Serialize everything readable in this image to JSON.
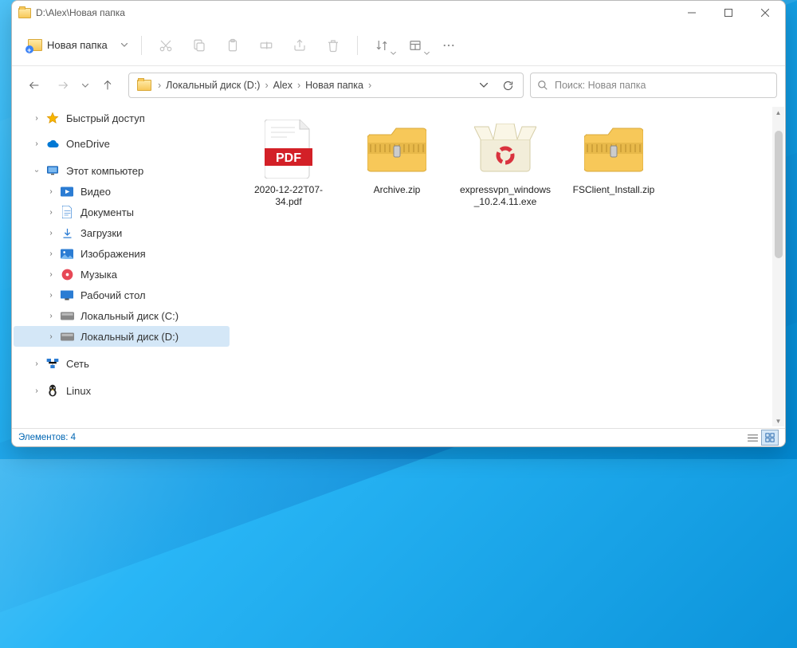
{
  "window": {
    "title": "D:\\Alex\\Новая папка"
  },
  "toolbar": {
    "new_label": "Новая папка"
  },
  "breadcrumb": {
    "items": [
      "Локальный диск (D:)",
      "Alex",
      "Новая папка"
    ]
  },
  "search": {
    "placeholder": "Поиск: Новая папка"
  },
  "sidebar": {
    "quick_access": "Быстрый доступ",
    "onedrive": "OneDrive",
    "this_pc": "Этот компьютер",
    "pc_children": [
      "Видео",
      "Документы",
      "Загрузки",
      "Изображения",
      "Музыка",
      "Рабочий стол",
      "Локальный диск (C:)",
      "Локальный диск (D:)"
    ],
    "network": "Сеть",
    "linux": "Linux"
  },
  "files": [
    {
      "name": "2020-12-22T07-34.pdf",
      "type": "pdf"
    },
    {
      "name": "Archive.zip",
      "type": "zip"
    },
    {
      "name": "expressvpn_windows_10.2.4.11.exe",
      "type": "exe"
    },
    {
      "name": "FSClient_Install.zip",
      "type": "zip"
    }
  ],
  "statusbar": {
    "text": "Элементов: 4"
  }
}
